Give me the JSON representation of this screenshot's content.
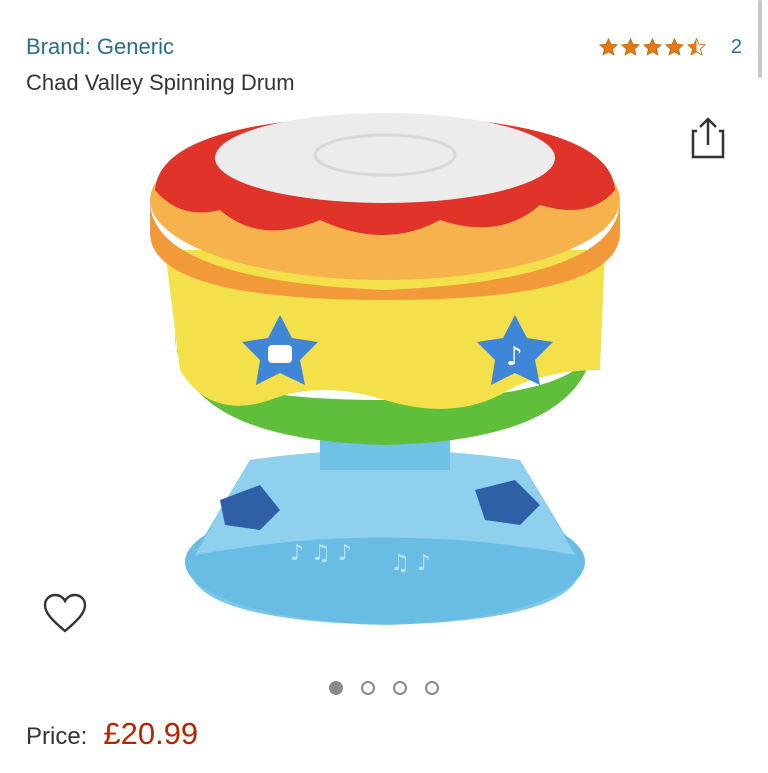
{
  "product": {
    "brand": "Brand: Generic",
    "title": "Chad Valley Spinning Drum"
  },
  "rating": {
    "stars": 4.5,
    "count": "2",
    "star_color": "#e47911"
  },
  "icons": {
    "share": "share-icon",
    "wishlist": "heart-outline-icon"
  },
  "carousel": {
    "total": 4,
    "active_index": 0
  },
  "price": {
    "label": "Price:",
    "value": "£20.99",
    "color": "#b12704"
  }
}
